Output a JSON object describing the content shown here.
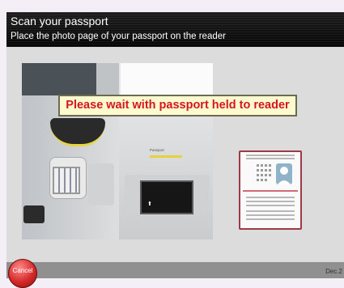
{
  "header": {
    "title": "Scan your passport",
    "subtitle": "Place the photo page of your passport on the reader"
  },
  "banner": {
    "message": "Please wait with passport held to reader"
  },
  "photo": {
    "passport_label": "Passport"
  },
  "footer": {
    "cancel_label": "Cancel",
    "date_text": "Dec.2"
  },
  "colors": {
    "banner_text": "#d4171e",
    "banner_bg": "#fdfad0",
    "cancel_button": "#d62a2a",
    "icon_border": "#9c3a46",
    "panel_bg": "#dcdcdc"
  },
  "icons": [
    "passport-placement-icon"
  ]
}
